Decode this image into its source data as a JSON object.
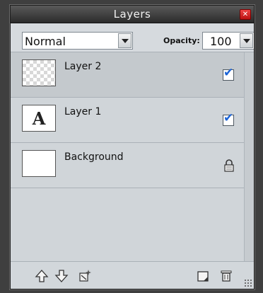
{
  "window": {
    "title": "Layers"
  },
  "controls": {
    "blend_mode": "Normal",
    "opacity_label": "Opacity:",
    "opacity_value": "100"
  },
  "layers": [
    {
      "name": "Layer 2",
      "thumbnail": "transparent-checker",
      "visible": true,
      "selected": true
    },
    {
      "name": "Layer 1",
      "thumbnail": "text-glyph",
      "thumbnail_text": "A",
      "visible": true,
      "selected": false
    },
    {
      "name": "Background",
      "thumbnail": "white",
      "locked": true,
      "selected": false
    }
  ],
  "toolbar": {
    "icons": [
      "move-layer-up-icon",
      "move-layer-down-icon",
      "layer-effects-icon",
      "new-layer-icon",
      "delete-layer-icon"
    ]
  },
  "colors": {
    "panel_bg": "#d4d9dd",
    "titlebar": "#2b2b2b",
    "selected_row": "#c4c9cd",
    "check_blue": "#1b63d6",
    "close_red": "#cc2222"
  }
}
